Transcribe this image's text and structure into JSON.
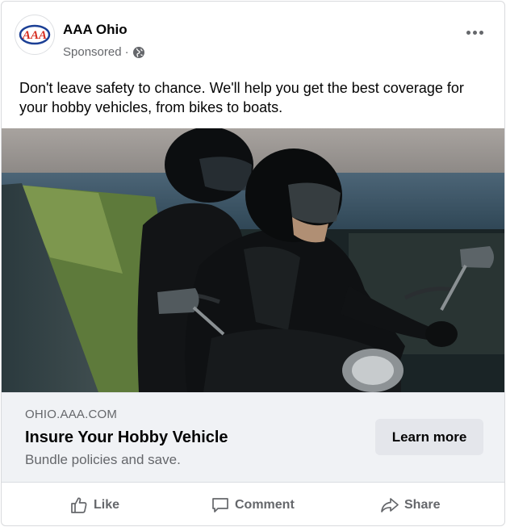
{
  "post": {
    "page_name": "AAA Ohio",
    "sponsored_label": "Sponsored",
    "separator": "·",
    "audience_icon": "globe-icon",
    "more_icon": "more-options-icon",
    "text": "Don't leave safety to chance. We'll help you get the best coverage for your hobby vehicles, from bikes to boats.",
    "logo_text": "AAA",
    "logo_colors": {
      "red": "#d52b1e",
      "blue": "#1b3f95"
    }
  },
  "link_card": {
    "domain": "OHIO.AAA.COM",
    "title": "Insure Your Hobby Vehicle",
    "description": "Bundle policies and save.",
    "cta_label": "Learn more"
  },
  "actions": {
    "like_label": "Like",
    "comment_label": "Comment",
    "share_label": "Share",
    "like_icon": "thumbs-up-icon",
    "comment_icon": "comment-bubble-icon",
    "share_icon": "share-arrow-icon"
  },
  "colors": {
    "text_primary": "#050505",
    "text_secondary": "#65676b",
    "card_background": "#f0f2f5",
    "button_background": "#e4e6eb"
  }
}
